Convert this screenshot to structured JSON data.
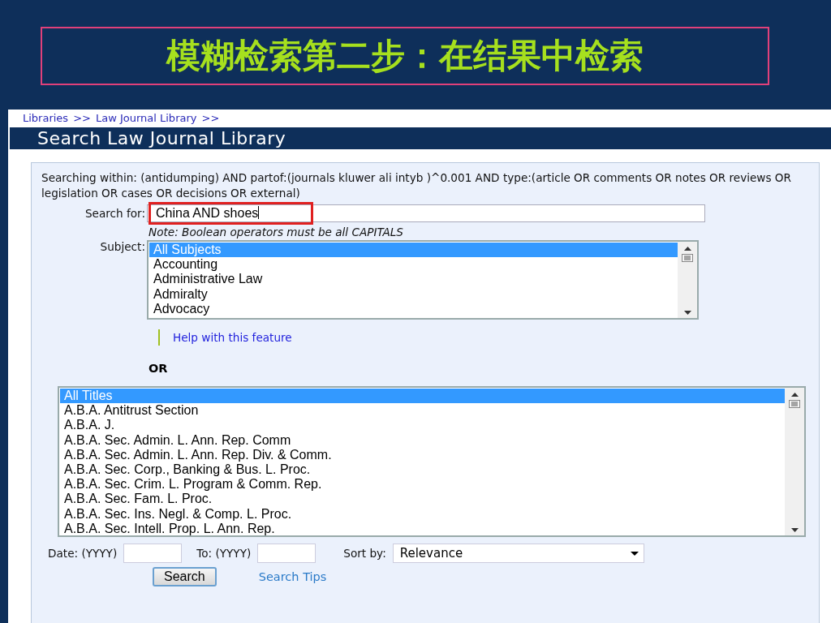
{
  "slide_title": "模糊检索第二步：在结果中检索",
  "breadcrumb": {
    "links": [
      "Libraries",
      "Law Journal Library"
    ],
    "separator": ">>"
  },
  "page_heading": "Search Law Journal Library",
  "search_scope": "Searching within: (antidumping) AND partof:(journals kluwer ali intyb )^0.001 AND type:(article OR comments OR notes OR reviews OR legislation OR cases OR decisions OR external)",
  "search_field": {
    "label": "Search for:",
    "value": "China AND shoes",
    "highlighted": true
  },
  "note": "Note: Boolean operators must be all CAPITALS",
  "subject": {
    "label": "Subject:",
    "options": [
      {
        "label": "All Subjects",
        "selected": true
      },
      {
        "label": "Accounting",
        "selected": false
      },
      {
        "label": "Administrative Law",
        "selected": false
      },
      {
        "label": "Admiralty",
        "selected": false
      },
      {
        "label": "Advocacy",
        "selected": false
      }
    ]
  },
  "help_link": "Help with this feature",
  "or_label": "OR",
  "titles": {
    "options": [
      {
        "label": "All Titles",
        "selected": true
      },
      {
        "label": "A.B.A. Antitrust Section",
        "selected": false
      },
      {
        "label": "A.B.A. J.",
        "selected": false
      },
      {
        "label": "A.B.A. Sec. Admin. L. Ann. Rep. Comm",
        "selected": false
      },
      {
        "label": "A.B.A. Sec. Admin. L. Ann. Rep. Div. & Comm.",
        "selected": false
      },
      {
        "label": "A.B.A. Sec. Corp., Banking & Bus. L. Proc.",
        "selected": false
      },
      {
        "label": "A.B.A. Sec. Crim. L. Program & Comm. Rep.",
        "selected": false
      },
      {
        "label": "A.B.A. Sec. Fam. L. Proc.",
        "selected": false
      },
      {
        "label": "A.B.A. Sec. Ins. Negl. & Comp. L. Proc.",
        "selected": false
      },
      {
        "label": "A.B.A. Sec. Intell. Prop. L. Ann. Rep.",
        "selected": false
      }
    ]
  },
  "date_from": {
    "label": "Date: (YYYY)"
  },
  "date_to": {
    "label": "To: (YYYY)"
  },
  "sort": {
    "label": "Sort by:",
    "value": "Relevance"
  },
  "search_button": "Search",
  "tips_link": "Search Tips"
}
